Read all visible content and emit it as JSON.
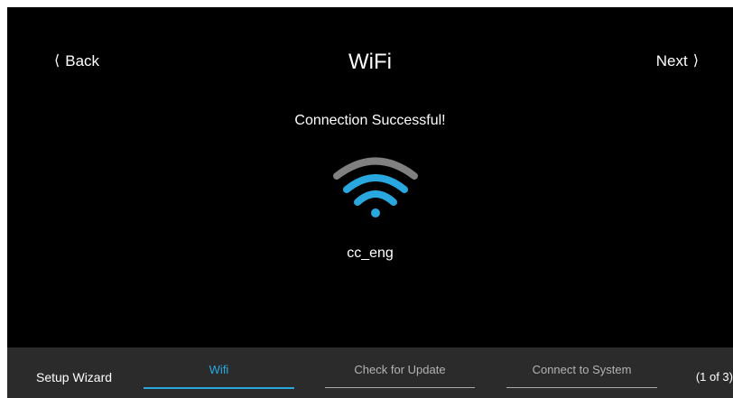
{
  "header": {
    "back_label": "Back",
    "back_icon": "chevron-left-icon",
    "title": "WiFi",
    "next_label": "Next",
    "next_icon": "chevron-right-icon"
  },
  "main": {
    "status": "Connection Successful!",
    "wifi_icon": "wifi-icon",
    "network_name": "cc_eng"
  },
  "footer": {
    "wizard_label": "Setup Wizard",
    "steps": [
      {
        "label": "Wifi",
        "active": true
      },
      {
        "label": "Check for Update",
        "active": false
      },
      {
        "label": "Connect to System",
        "active": false
      }
    ],
    "progress": "(1 of 3)"
  },
  "colors": {
    "background": "#000000",
    "footer_background": "#2b2b2b",
    "accent": "#29a8e0",
    "wifi_outer_arc": "#808080",
    "inactive_text": "#b3b3b3",
    "inactive_underline": "#aaaaaa"
  }
}
